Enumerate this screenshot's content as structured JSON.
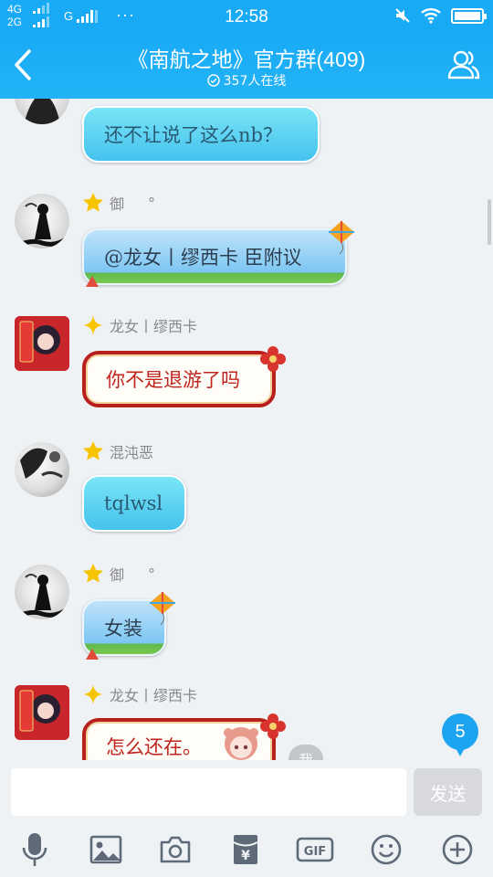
{
  "status_bar": {
    "net1": "4G",
    "net2": "2G",
    "net3": "G",
    "more": "···",
    "time": "12:58"
  },
  "header": {
    "title": "《南航之地》官方群(409)",
    "online": "357人在线"
  },
  "messages": [
    {
      "sender": "",
      "text": "还不让说了这么nb？",
      "avatar": "monochrome-anime-avatar",
      "style": "aqua-bubble"
    },
    {
      "sender": "御",
      "suffix": "°",
      "text": "@龙女丨缪西卡 臣附议",
      "avatar": "monochrome-anime-avatar",
      "style": "kite-bubble"
    },
    {
      "sender": "龙女丨缪西卡",
      "text": "你不是退游了吗",
      "avatar": "red-festive-avatar",
      "style": "red-festive-bubble"
    },
    {
      "sender": "混沌恶",
      "text": "tqlwsl",
      "avatar": "bw-anime-avatar",
      "style": "aqua-bubble"
    },
    {
      "sender": "御",
      "suffix": "°",
      "text": "女装",
      "avatar": "monochrome-anime-avatar",
      "style": "kite-bubble"
    },
    {
      "sender": "龙女丨缪西卡",
      "text": "怎么还在。",
      "avatar": "red-festive-avatar",
      "style": "red-festive-bubble"
    }
  ],
  "self_tag": "我",
  "unread_count": "5",
  "input": {
    "placeholder": "",
    "value": ""
  },
  "send_label": "发送",
  "toolbar": [
    {
      "icon": "microphone-icon"
    },
    {
      "icon": "image-icon"
    },
    {
      "icon": "camera-icon"
    },
    {
      "icon": "red-packet-icon"
    },
    {
      "icon": "gif-icon",
      "label": "GIF"
    },
    {
      "icon": "emoji-icon"
    },
    {
      "icon": "plus-icon"
    }
  ],
  "colors": {
    "primary": "#18aaf5",
    "background": "#eff2f5",
    "star": "#f7c400",
    "festive_red": "#b8201d"
  }
}
